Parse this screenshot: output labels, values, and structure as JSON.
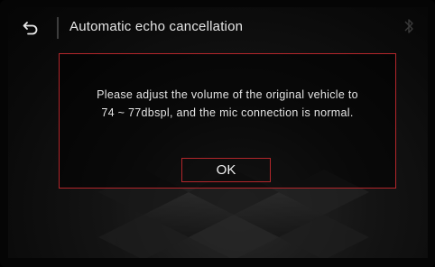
{
  "header": {
    "title": "Automatic echo cancellation",
    "back_icon": "back-arrow-icon",
    "status_icon": "bluetooth-icon"
  },
  "dialog": {
    "message_line1": "Please adjust the volume of the original vehicle to",
    "message_line2": "74 ~ 77dbspl,  and the mic connection is normal.",
    "ok_label": "OK"
  },
  "colors": {
    "accent_border": "#b3262b",
    "text": "#e4e4e4",
    "background": "#0a0a0a"
  }
}
